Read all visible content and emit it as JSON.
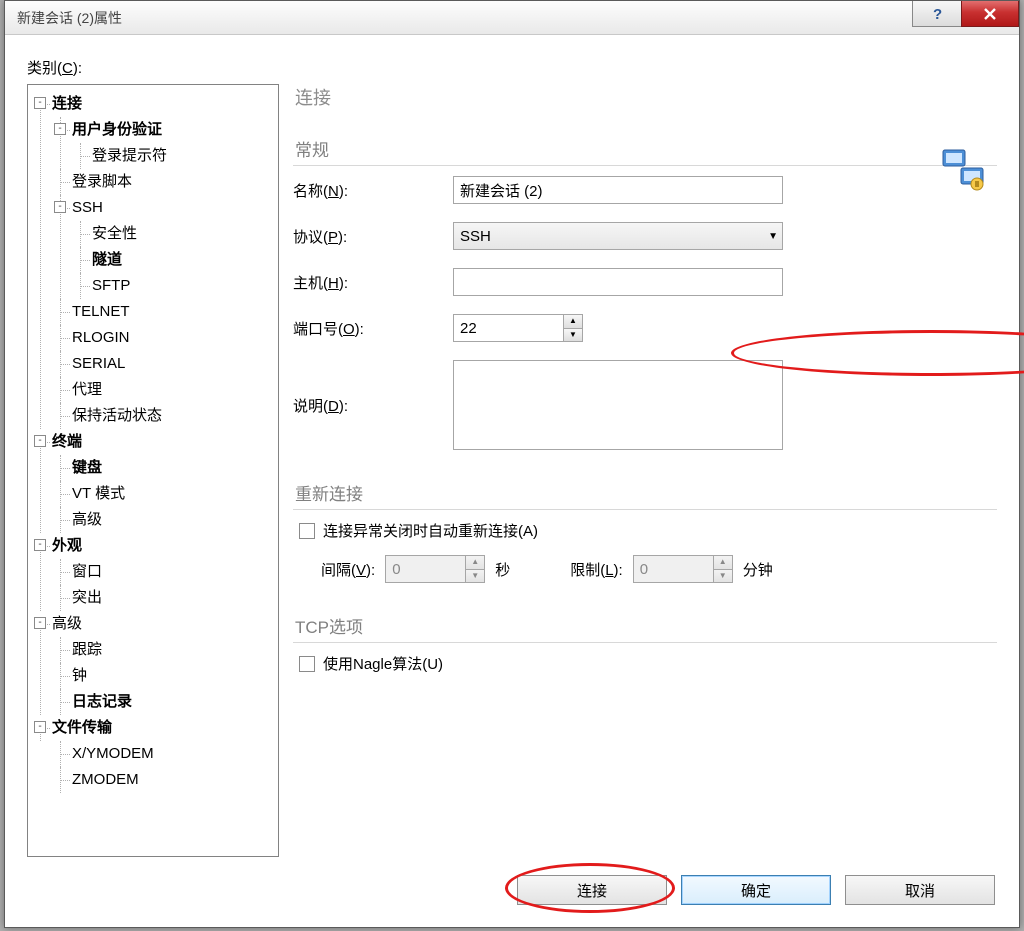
{
  "window": {
    "title": "新建会话 (2)属性"
  },
  "category_label": {
    "pre": "类别(",
    "ak": "C",
    "post": "):"
  },
  "tree": [
    {
      "label": "连接",
      "bold": true,
      "exp": "-",
      "children": [
        {
          "label": "用户身份验证",
          "bold": true,
          "exp": "-",
          "children": [
            {
              "label": "登录提示符"
            }
          ]
        },
        {
          "label": "登录脚本"
        },
        {
          "label": "SSH",
          "exp": "-",
          "children": [
            {
              "label": "安全性"
            },
            {
              "label": "隧道",
              "bold": true
            },
            {
              "label": "SFTP"
            }
          ]
        },
        {
          "label": "TELNET"
        },
        {
          "label": "RLOGIN"
        },
        {
          "label": "SERIAL"
        },
        {
          "label": "代理"
        },
        {
          "label": "保持活动状态"
        }
      ]
    },
    {
      "label": "终端",
      "bold": true,
      "exp": "-",
      "children": [
        {
          "label": "键盘",
          "bold": true
        },
        {
          "label": "VT 模式"
        },
        {
          "label": "高级"
        }
      ]
    },
    {
      "label": "外观",
      "bold": true,
      "exp": "-",
      "children": [
        {
          "label": "窗口"
        },
        {
          "label": "突出"
        }
      ]
    },
    {
      "label": "高级",
      "exp": "-",
      "children": [
        {
          "label": "跟踪"
        },
        {
          "label": "钟"
        },
        {
          "label": "日志记录",
          "bold": true
        }
      ]
    },
    {
      "label": "文件传输",
      "bold": true,
      "exp": "-",
      "children": [
        {
          "label": "X/YMODEM"
        },
        {
          "label": "ZMODEM"
        }
      ]
    }
  ],
  "form": {
    "page_title": "连接",
    "general": {
      "title": "常规",
      "name": {
        "pre": "名称(",
        "ak": "N",
        "post": "):",
        "value": "新建会话 (2)"
      },
      "protocol": {
        "pre": "协议(",
        "ak": "P",
        "post": "):",
        "value": "SSH"
      },
      "host": {
        "pre": "主机(",
        "ak": "H",
        "post": "):",
        "value": ""
      },
      "port": {
        "pre": "端口号(",
        "ak": "O",
        "post": "):",
        "value": "22"
      },
      "desc": {
        "pre": "说明(",
        "ak": "D",
        "post": "):",
        "value": ""
      }
    },
    "reconnect": {
      "title": "重新连接",
      "auto": {
        "pre": "连接异常关闭时自动重新连接(",
        "ak": "A",
        "post": ")"
      },
      "interval": {
        "pre": "间隔(",
        "ak": "V",
        "post": "):",
        "value": "0",
        "unit": "秒"
      },
      "limit": {
        "pre": "限制(",
        "ak": "L",
        "post": "):",
        "value": "0",
        "unit": "分钟"
      }
    },
    "tcp": {
      "title": "TCP选项",
      "nagle": {
        "pre": "使用Nagle算法(",
        "ak": "U",
        "post": ")"
      }
    }
  },
  "buttons": {
    "connect": "连接",
    "ok": "确定",
    "cancel": "取消"
  }
}
